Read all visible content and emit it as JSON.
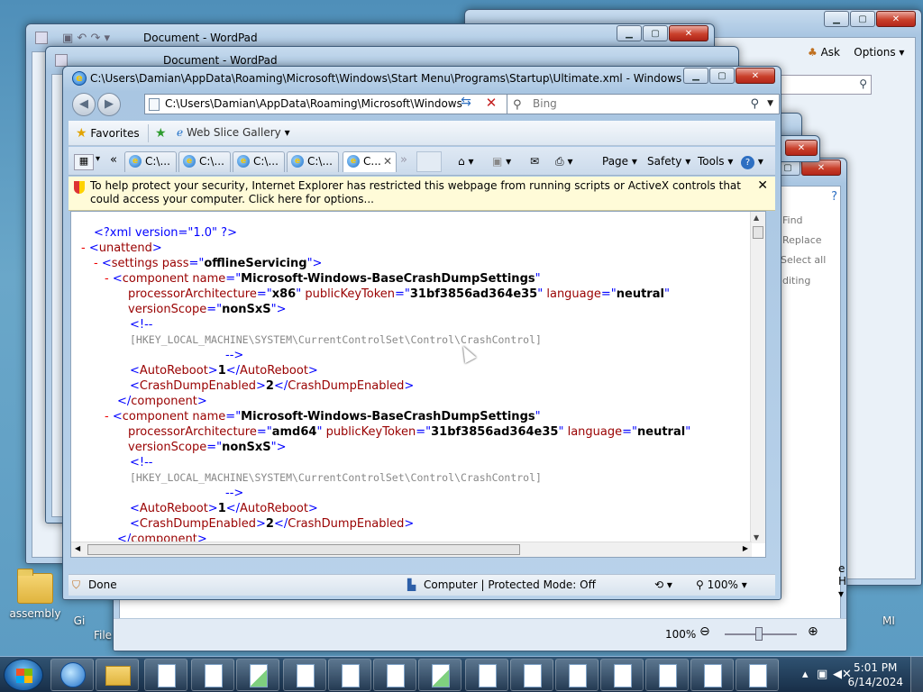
{
  "desktop": {
    "icons": [
      {
        "label": "assembly"
      },
      {
        "label": "Gi"
      },
      {
        "label": "File"
      },
      {
        "label": "MI"
      }
    ]
  },
  "bg_windows": {
    "wordpad1_title": "Document - WordPad",
    "wordpad2_title": "Document - WordPad",
    "ask_label": "Ask",
    "options_label": "Options",
    "find_label": "Find",
    "replace_label": "Replace",
    "select_all_label": "Select all",
    "editing_label": "diting",
    "help_label": "e Help",
    "zoom_value": "100%"
  },
  "ie": {
    "title": "C:\\Users\\Damian\\AppData\\Roaming\\Microsoft\\Windows\\Start Menu\\Programs\\Startup\\Ultimate.xml - Windows Internet E...",
    "address": "C:\\Users\\Damian\\AppData\\Roaming\\Microsoft\\Windows",
    "search_placeholder": "Bing",
    "favorites_label": "Favorites",
    "web_slice_label": "Web Slice Gallery",
    "tabs": [
      {
        "label": "C:\\..."
      },
      {
        "label": "C:\\..."
      },
      {
        "label": "C:\\..."
      },
      {
        "label": "C:\\..."
      },
      {
        "label": "C..."
      }
    ],
    "commands": {
      "page": "Page",
      "safety": "Safety",
      "tools": "Tools"
    },
    "infobar": "To help protect your security, Internet Explorer has restricted this webpage from running scripts or ActiveX controls that could access your computer. Click here for options...",
    "status_text": "Done",
    "zone_text": "Computer | Protected Mode: Off",
    "zoom": "100%"
  },
  "xml": {
    "decl": "<?xml version=\"1.0\" ?>",
    "unattend": "unattend",
    "settings_pass": "offlineServicing",
    "component_name": "Microsoft-Windows-BaseCrashDumpSettings",
    "pkt": "31bf3856ad364e35",
    "lang": "neutral",
    "scope": "nonSxS",
    "arch1": "x86",
    "arch2": "amd64",
    "comment_open": "<!--",
    "comment_path": "[HKEY_LOCAL_MACHINE\\SYSTEM\\CurrentControlSet\\Control\\CrashControl]",
    "comment_close": "-->",
    "autoreboot_val": "1",
    "crashdump_val": "2"
  },
  "taskbar": {
    "time": "5:01 PM",
    "date": "6/14/2024"
  }
}
